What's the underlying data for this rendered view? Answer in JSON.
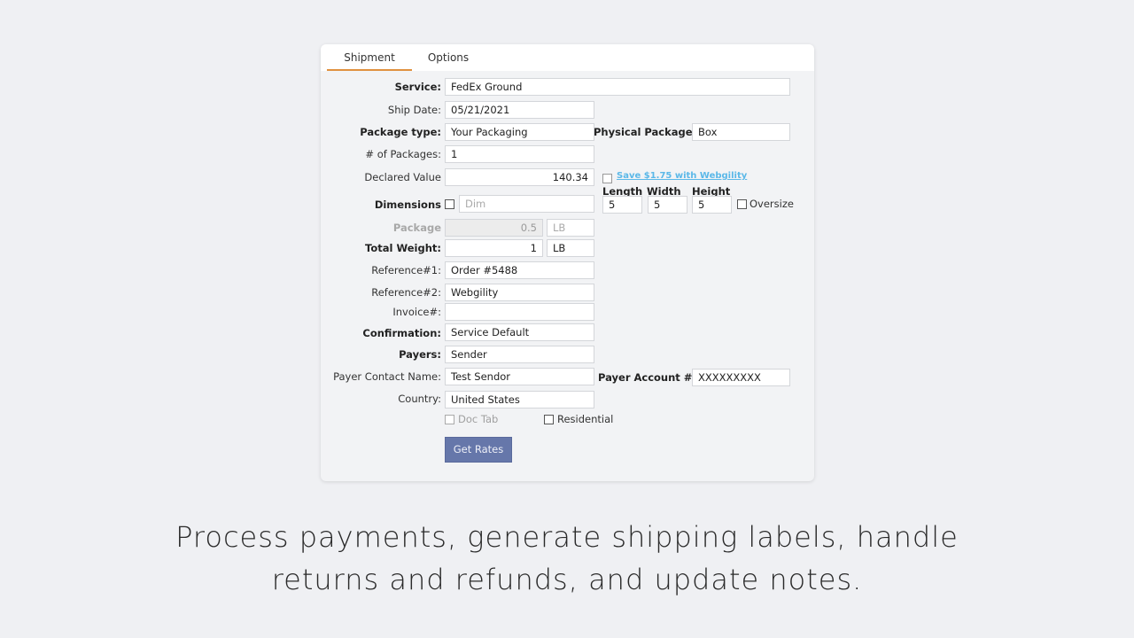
{
  "tabs": [
    {
      "label": "Shipment",
      "active": true
    },
    {
      "label": "Options",
      "active": false
    }
  ],
  "form": {
    "service": {
      "label": "Service:",
      "value": "FedEx Ground"
    },
    "ship_date": {
      "label": "Ship Date:",
      "value": "05/21/2021"
    },
    "package_type": {
      "label": "Package type:",
      "value": "Your Packaging"
    },
    "physical_package": {
      "label": "Physical Package:",
      "value": "Box"
    },
    "num_packages": {
      "label": "# of Packages:",
      "value": "1"
    },
    "declared_value": {
      "label": "Declared Value",
      "value": "140.34"
    },
    "save_link": "Save $1.75 with Webgility",
    "dimensions": {
      "label": "Dimensions",
      "placeholder": "Dim",
      "checked": false
    },
    "length": {
      "label": "Length",
      "value": "5"
    },
    "width": {
      "label": "Width",
      "value": "5"
    },
    "height": {
      "label": "Height",
      "value": "5"
    },
    "oversize": {
      "label": "Oversize",
      "checked": false
    },
    "package_weight": {
      "label": "Package",
      "value": "0.5",
      "unit": "LB"
    },
    "total_weight": {
      "label": "Total Weight:",
      "value": "1",
      "unit": "LB"
    },
    "reference1": {
      "label": "Reference#1:",
      "value": "Order #5488"
    },
    "reference2": {
      "label": "Reference#2:",
      "value": "Webgility"
    },
    "invoice": {
      "label": "Invoice#:",
      "value": ""
    },
    "confirmation": {
      "label": "Confirmation:",
      "value": "Service Default"
    },
    "payers": {
      "label": "Payers:",
      "value": "Sender"
    },
    "payer_contact_name": {
      "label": "Payer Contact Name:",
      "value": "Test Sendor"
    },
    "payer_account": {
      "label": "Payer Account #:",
      "value": "XXXXXXXXX"
    },
    "country": {
      "label": "Country:",
      "value": "United States"
    },
    "doc_tab": {
      "label": "Doc Tab",
      "checked": false
    },
    "residential": {
      "label": "Residential",
      "checked": false
    },
    "get_rates_label": "Get Rates"
  },
  "caption": {
    "line1": "Process payments, generate shipping labels, handle",
    "line2": "returns and refunds, and update notes."
  },
  "colors": {
    "tab_accent": "#e0913f",
    "button": "#6677aa",
    "link": "#5bb8e8"
  }
}
